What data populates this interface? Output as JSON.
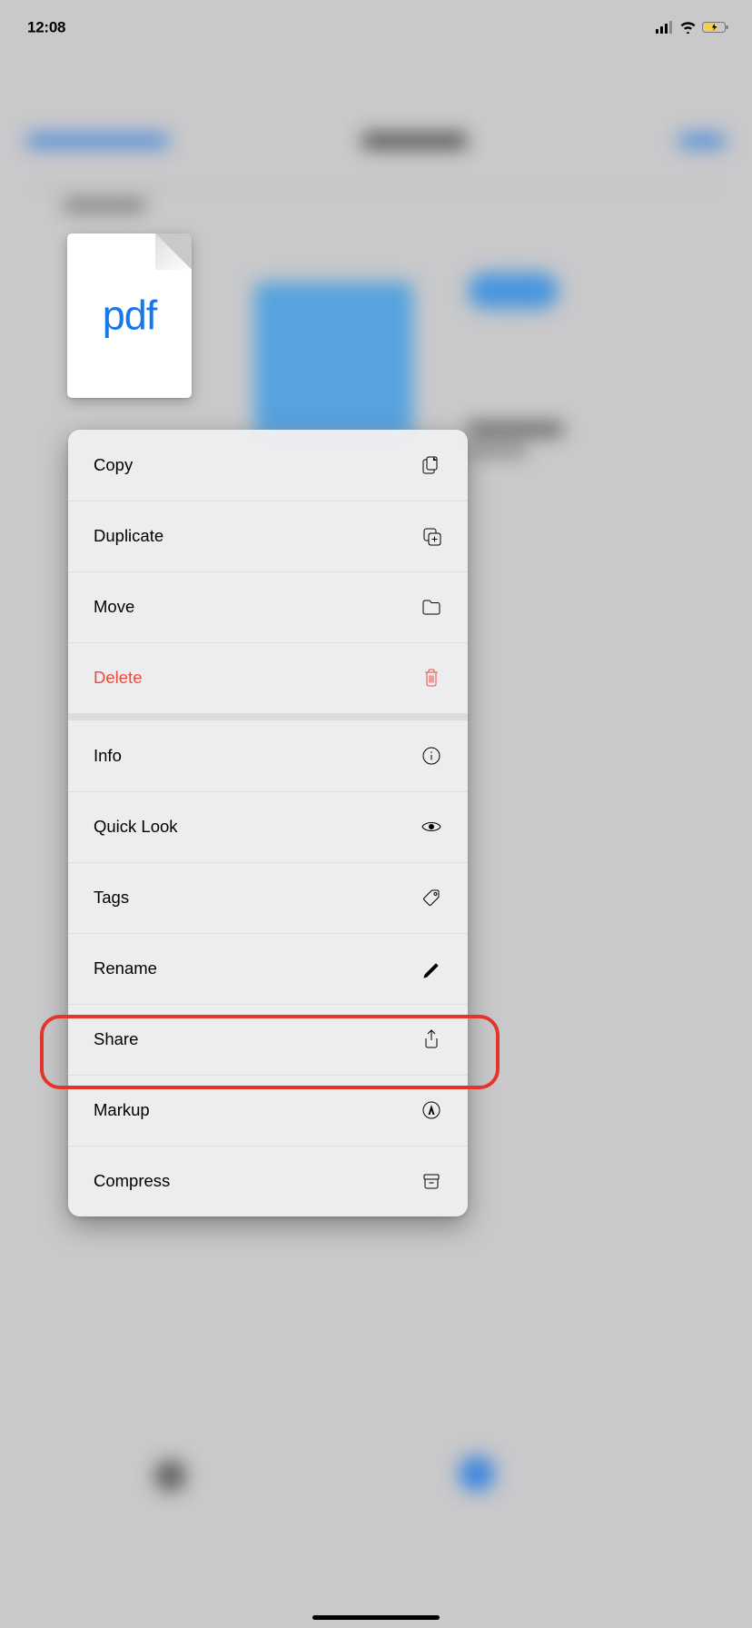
{
  "status": {
    "time": "12:08"
  },
  "file": {
    "type_label": "pdf"
  },
  "menu": {
    "groups": [
      [
        {
          "id": "copy",
          "label": "Copy",
          "icon": "copy-icon",
          "destructive": false
        },
        {
          "id": "duplicate",
          "label": "Duplicate",
          "icon": "duplicate-icon",
          "destructive": false
        },
        {
          "id": "move",
          "label": "Move",
          "icon": "folder-icon",
          "destructive": false
        },
        {
          "id": "delete",
          "label": "Delete",
          "icon": "trash-icon",
          "destructive": true
        }
      ],
      [
        {
          "id": "info",
          "label": "Info",
          "icon": "info-icon",
          "destructive": false
        },
        {
          "id": "quick-look",
          "label": "Quick Look",
          "icon": "eye-icon",
          "destructive": false
        },
        {
          "id": "tags",
          "label": "Tags",
          "icon": "tag-icon",
          "destructive": false
        },
        {
          "id": "rename",
          "label": "Rename",
          "icon": "pencil-icon",
          "destructive": false
        },
        {
          "id": "share",
          "label": "Share",
          "icon": "share-icon",
          "destructive": false
        },
        {
          "id": "markup",
          "label": "Markup",
          "icon": "markup-icon",
          "destructive": false
        },
        {
          "id": "compress",
          "label": "Compress",
          "icon": "archive-icon",
          "destructive": false
        }
      ]
    ]
  },
  "annotation": {
    "highlighted_item_id": "share"
  }
}
